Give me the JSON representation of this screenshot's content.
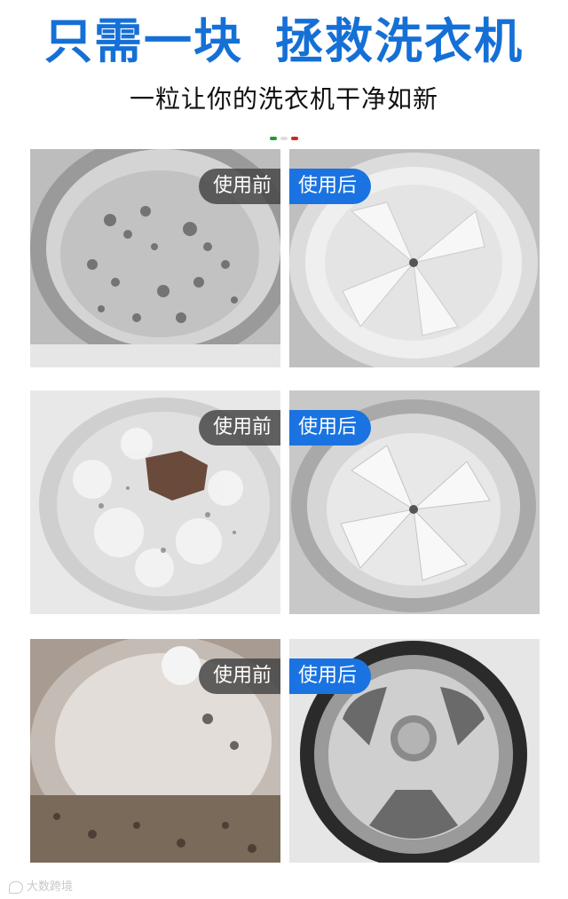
{
  "title": {
    "part1": "只需一块",
    "part2": "拯救洗衣机"
  },
  "subtitle": "一粒让你的洗衣机干净如新",
  "badges": {
    "before": "使用前",
    "after": "使用后"
  },
  "colors": {
    "brand_blue": "#1570d6",
    "badge_blue": "#1a73e0",
    "badge_gray": "#464646"
  },
  "rows": [
    {
      "before_label": "使用前",
      "after_label": "使用后"
    },
    {
      "before_label": "使用前",
      "after_label": "使用后"
    },
    {
      "before_label": "使用前",
      "after_label": "使用后"
    }
  ],
  "watermark": "大数跨境"
}
